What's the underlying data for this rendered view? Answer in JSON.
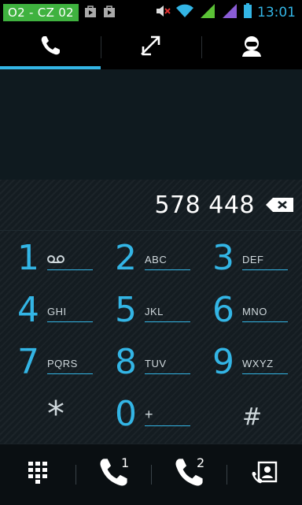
{
  "status_bar": {
    "carrier": "O2 - CZ 02",
    "time": "13:01",
    "icons": [
      "bag-icon",
      "bag-icon",
      "volume-muted-icon",
      "wifi-icon",
      "signal-icon",
      "signal-icon",
      "battery-icon"
    ]
  },
  "tabs": [
    {
      "icon": "phone-icon",
      "active": true
    },
    {
      "icon": "call-log-icon",
      "active": false
    },
    {
      "icon": "contact-icon",
      "active": false
    }
  ],
  "dialer": {
    "number": "578 448"
  },
  "keypad": {
    "keys": [
      {
        "num": "1",
        "letters": "",
        "voicemail": true
      },
      {
        "num": "2",
        "letters": "ABC"
      },
      {
        "num": "3",
        "letters": "DEF"
      },
      {
        "num": "4",
        "letters": "GHI"
      },
      {
        "num": "5",
        "letters": "JKL"
      },
      {
        "num": "6",
        "letters": "MNO"
      },
      {
        "num": "7",
        "letters": "PQRS"
      },
      {
        "num": "8",
        "letters": "TUV"
      },
      {
        "num": "9",
        "letters": "WXYZ"
      },
      {
        "num": "*",
        "letters": ""
      },
      {
        "num": "0",
        "letters": "+"
      },
      {
        "num": "#",
        "letters": ""
      }
    ]
  },
  "bottom_bar": {
    "sim1_label": "1",
    "sim2_label": "2"
  },
  "colors": {
    "accent": "#33b5e5",
    "carrier_bg": "#3fb23f"
  }
}
